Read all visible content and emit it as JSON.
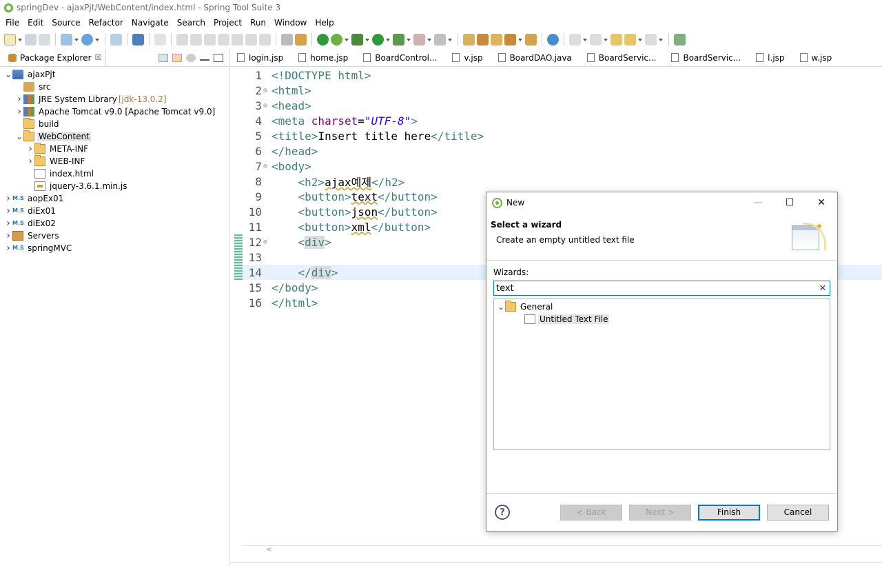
{
  "window": {
    "title": "springDev - ajaxPjt/WebContent/index.html - Spring Tool Suite 3"
  },
  "menu": [
    "File",
    "Edit",
    "Source",
    "Refactor",
    "Navigate",
    "Search",
    "Project",
    "Run",
    "Window",
    "Help"
  ],
  "package_explorer": {
    "tab_label": "Package Explorer",
    "tab_close": "☒",
    "tree": [
      {
        "label": "ajaxPjt",
        "icon": "project-icon",
        "depth": 0,
        "twisty": "v"
      },
      {
        "label": "src",
        "icon": "package-folder-icon",
        "depth": 1,
        "twisty": ""
      },
      {
        "label": "JRE System Library",
        "suffix": "[jdk-13.0.2]",
        "icon": "library-icon",
        "depth": 1,
        "twisty": ">"
      },
      {
        "label": "Apache Tomcat v9.0 [Apache Tomcat v9.0]",
        "suffix": "",
        "icon": "library-icon",
        "depth": 1,
        "twisty": ">"
      },
      {
        "label": "build",
        "icon": "folder-icon",
        "depth": 1,
        "twisty": ""
      },
      {
        "label": "WebContent",
        "icon": "folder-icon",
        "depth": 1,
        "twisty": "v",
        "selected": true
      },
      {
        "label": "META-INF",
        "icon": "folder-icon",
        "depth": 2,
        "twisty": ">"
      },
      {
        "label": "WEB-INF",
        "icon": "folder-icon",
        "depth": 2,
        "twisty": ">"
      },
      {
        "label": "index.html",
        "icon": "file-icon",
        "depth": 2,
        "twisty": ""
      },
      {
        "label": "jquery-3.6.1.min.js",
        "icon": "js-file-icon",
        "depth": 2,
        "twisty": ""
      },
      {
        "label": "aopEx01",
        "icon": "maven-project-icon",
        "depth": 0,
        "twisty": ">"
      },
      {
        "label": "diEx01",
        "icon": "maven-project-icon",
        "depth": 0,
        "twisty": ">"
      },
      {
        "label": "diEx02",
        "icon": "maven-project-icon",
        "depth": 0,
        "twisty": ">"
      },
      {
        "label": "Servers",
        "icon": "servers-folder-icon",
        "depth": 0,
        "twisty": ">"
      },
      {
        "label": "springMVC",
        "icon": "maven-project-icon",
        "depth": 0,
        "twisty": ">"
      }
    ]
  },
  "editor_tabs": [
    "login.jsp",
    "home.jsp",
    "BoardControl...",
    "v.jsp",
    "BoardDAO.java",
    "BoardServic...",
    "BoardServic...",
    "l.jsp",
    "w.jsp"
  ],
  "code_lines": [
    {
      "n": "1",
      "fold": "",
      "segs": [
        [
          "tag",
          "<!DOCTYPE html>"
        ]
      ]
    },
    {
      "n": "2",
      "fold": "⊖",
      "segs": [
        [
          "tag",
          "<html>"
        ]
      ]
    },
    {
      "n": "3",
      "fold": "⊖",
      "segs": [
        [
          "tag",
          "<head>"
        ]
      ]
    },
    {
      "n": "4",
      "fold": "",
      "segs": [
        [
          "tag",
          "<meta "
        ],
        [
          "attr",
          "charset"
        ],
        [
          "txt",
          "="
        ],
        [
          "str",
          "\"UTF-8\""
        ],
        [
          "tag",
          ">"
        ]
      ]
    },
    {
      "n": "5",
      "fold": "",
      "segs": [
        [
          "tag",
          "<title>"
        ],
        [
          "txt",
          "Insert title here"
        ],
        [
          "tag",
          "</title>"
        ]
      ]
    },
    {
      "n": "6",
      "fold": "",
      "segs": [
        [
          "tag",
          "</head>"
        ]
      ]
    },
    {
      "n": "7",
      "fold": "⊖",
      "segs": [
        [
          "tag",
          "<body>"
        ]
      ]
    },
    {
      "n": "8",
      "fold": "",
      "segs": [
        [
          "txt",
          "    "
        ],
        [
          "tag",
          "<h2>"
        ],
        [
          "wavy",
          "ajax예제"
        ],
        [
          "tag",
          "</h2>"
        ]
      ]
    },
    {
      "n": "9",
      "fold": "",
      "segs": [
        [
          "txt",
          "    "
        ],
        [
          "tag",
          "<button>"
        ],
        [
          "wavy",
          "text"
        ],
        [
          "tag",
          "</button>"
        ]
      ]
    },
    {
      "n": "10",
      "fold": "",
      "segs": [
        [
          "txt",
          "    "
        ],
        [
          "tag",
          "<button>"
        ],
        [
          "wavy",
          "json"
        ],
        [
          "tag",
          "</button>"
        ]
      ]
    },
    {
      "n": "11",
      "fold": "",
      "segs": [
        [
          "txt",
          "    "
        ],
        [
          "tag",
          "<button>"
        ],
        [
          "wavy",
          "xml"
        ],
        [
          "tag",
          "</button>"
        ]
      ]
    },
    {
      "n": "12",
      "fold": "⊖",
      "segs": [
        [
          "txt",
          "    "
        ],
        [
          "tag",
          "<"
        ],
        [
          "box",
          "div"
        ],
        [
          "tag",
          ">"
        ]
      ]
    },
    {
      "n": "13",
      "fold": "",
      "segs": [
        [
          "txt",
          ""
        ]
      ]
    },
    {
      "n": "14",
      "fold": "",
      "hl": true,
      "segs": [
        [
          "txt",
          "    "
        ],
        [
          "tag",
          "</"
        ],
        [
          "box",
          "div"
        ],
        [
          "tag",
          ">"
        ]
      ]
    },
    {
      "n": "15",
      "fold": "",
      "segs": [
        [
          "tag",
          "</body>"
        ]
      ]
    },
    {
      "n": "16",
      "fold": "",
      "segs": [
        [
          "tag",
          "</html>"
        ]
      ]
    }
  ],
  "dialog": {
    "title": "New",
    "header": "Select a wizard",
    "description": "Create an empty untitled text file",
    "wizards_label": "Wizards:",
    "filter_value": "text",
    "clear_glyph": "✕",
    "tree": [
      {
        "label": "General",
        "depth": 0,
        "twisty": "v",
        "icon": "folder-icon"
      },
      {
        "label": "Untitled Text File",
        "depth": 1,
        "twisty": "",
        "icon": "text-file-icon",
        "selected": true
      }
    ],
    "help_glyph": "?",
    "buttons": {
      "back": "< Back",
      "next": "Next >",
      "finish": "Finish",
      "cancel": "Cancel"
    }
  }
}
